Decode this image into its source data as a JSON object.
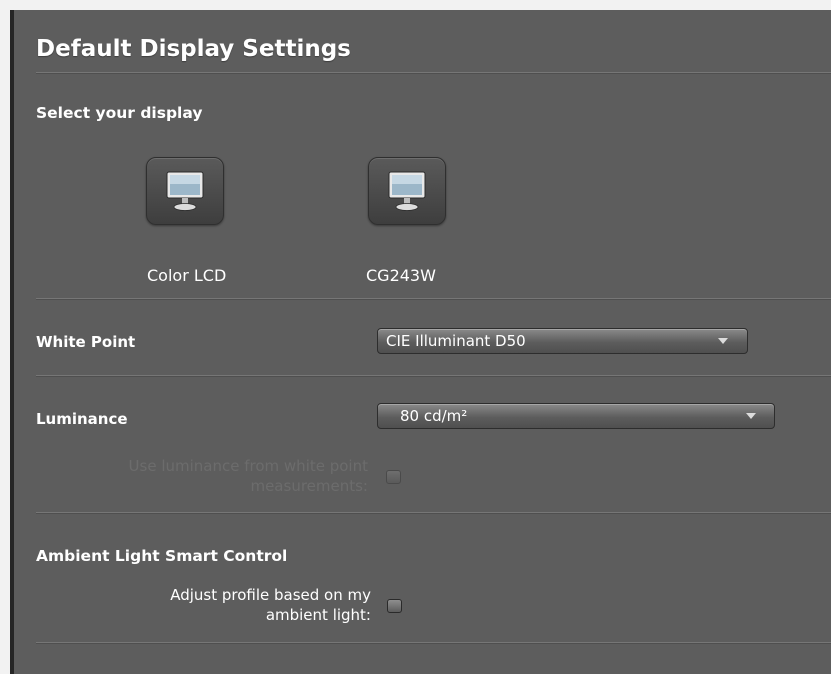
{
  "header": {
    "title": "Default Display Settings"
  },
  "display_section": {
    "label": "Select your display",
    "displays": [
      {
        "label": "Color LCD",
        "icon": "monitor-icon"
      },
      {
        "label": "CG243W",
        "icon": "monitor-icon"
      }
    ]
  },
  "white_point": {
    "label": "White Point",
    "value": "CIE Illuminant D50"
  },
  "luminance": {
    "label": "Luminance",
    "value": "80 cd/m²",
    "use_from_white_point_line1": "Use luminance from white point",
    "use_from_white_point_line2": "measurements:",
    "checked": false,
    "enabled": false
  },
  "ambient": {
    "label": "Ambient Light Smart Control",
    "adjust_line1": "Adjust profile based on my",
    "adjust_line2": "ambient light:",
    "checked": false
  },
  "colors": {
    "panel": "#5d5d5d",
    "text": "#ffffff",
    "disabled_text": "#6c6c6c"
  }
}
